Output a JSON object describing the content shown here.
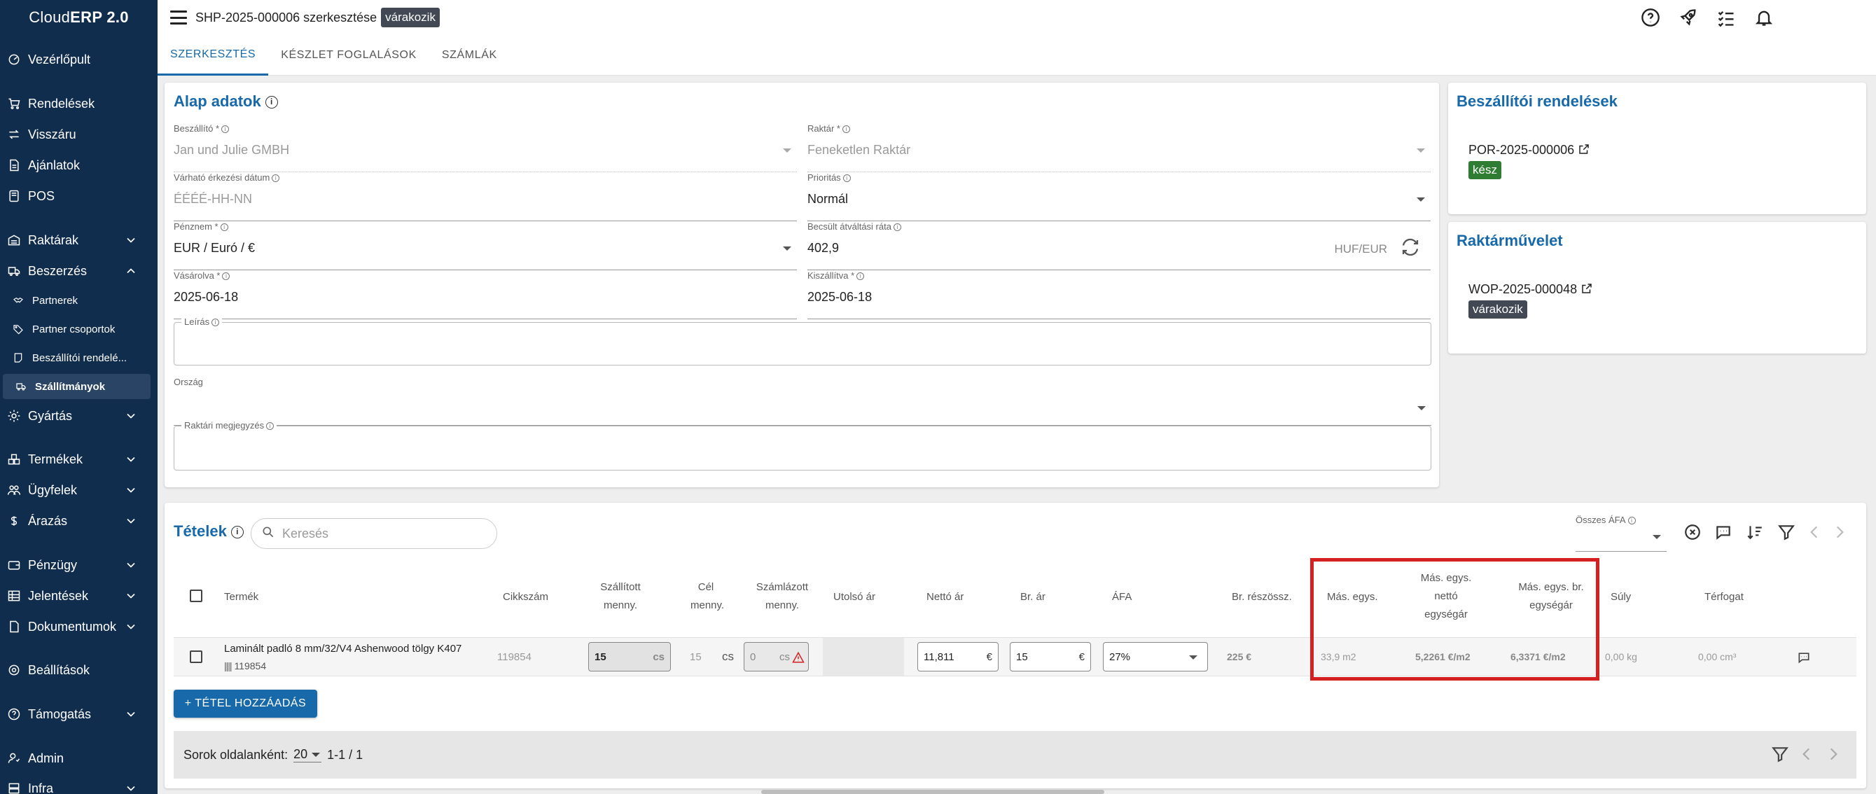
{
  "app": {
    "logo_prefix": "Cloud",
    "logo_bold": "ERP 2.0"
  },
  "sidebar": {
    "items": [
      {
        "label": "Vezérlőpult",
        "icon": "dashboard-icon"
      },
      {
        "label": "Rendelések",
        "icon": "cart-icon"
      },
      {
        "label": "Visszáru",
        "icon": "return-arrows-icon"
      },
      {
        "label": "Ajánlatok",
        "icon": "document-icon"
      },
      {
        "label": "POS",
        "icon": "pos-icon"
      },
      {
        "label": "Raktárak",
        "icon": "warehouse-icon"
      },
      {
        "label": "Beszerzés",
        "icon": "truck-icon"
      },
      {
        "label": "Partnerek",
        "icon": "handshake-icon"
      },
      {
        "label": "Partner csoportok",
        "icon": "tag-icon"
      },
      {
        "label": "Beszállítói rendelé...",
        "icon": "note-icon"
      },
      {
        "label": "Szállítmányok",
        "icon": "truck-icon"
      },
      {
        "label": "Gyártás",
        "icon": "gear-icon"
      },
      {
        "label": "Termékek",
        "icon": "boxes-icon"
      },
      {
        "label": "Ügyfelek",
        "icon": "users-icon"
      },
      {
        "label": "Árazás",
        "icon": "dollar-icon"
      },
      {
        "label": "Pénzügy",
        "icon": "wallet-icon"
      },
      {
        "label": "Jelentések",
        "icon": "table-icon"
      },
      {
        "label": "Dokumentumok",
        "icon": "file-icon"
      },
      {
        "label": "Beállítások",
        "icon": "settings-icon"
      },
      {
        "label": "Támogatás",
        "icon": "help-icon"
      },
      {
        "label": "Admin",
        "icon": "admin-icon"
      },
      {
        "label": "Infra",
        "icon": "server-icon"
      }
    ]
  },
  "header": {
    "title": "SHP-2025-000006 szerkesztése",
    "status": "várakozik"
  },
  "tabs": [
    "SZERKESZTÉS",
    "KÉSZLET FOGLALÁSOK",
    "SZÁMLÁK"
  ],
  "basic": {
    "title": "Alap adatok",
    "supplier_label": "Beszállító *",
    "supplier_value": "Jan und Julie GMBH",
    "warehouse_label": "Raktár *",
    "warehouse_value": "Feneketlen Raktár",
    "arrival_label": "Várható érkezési dátum",
    "arrival_placeholder": "ÉÉÉÉ-HH-NN",
    "priority_label": "Prioritás",
    "priority_value": "Normál",
    "currency_label": "Pénznem *",
    "currency_value": "EUR / Euró / €",
    "rate_label": "Becsült átváltási ráta",
    "rate_value": "402,9",
    "rate_unit": "HUF/EUR",
    "purchased_label": "Vásárolva *",
    "purchased_value": "2025-06-18",
    "shipped_label": "Kiszállítva *",
    "shipped_value": "2025-06-18",
    "description_label": "Leírás",
    "country_label": "Ország",
    "warehouse_note_label": "Raktári megjegyzés"
  },
  "supplier_orders": {
    "title": "Beszállítói rendelések",
    "code": "POR-2025-000006",
    "status": "kész"
  },
  "warehouse_ops": {
    "title": "Raktárművelet",
    "code": "WOP-2025-000048",
    "status": "várakozik"
  },
  "items": {
    "title": "Tételek",
    "search_placeholder": "Keresés",
    "vat_total_label": "Összes ÁFA",
    "columns": {
      "product": "Termék",
      "sku": "Cikkszám",
      "shipped_qty": "Szállított menny.",
      "target_qty": "Cél menny.",
      "invoiced_qty": "Számlázott menny.",
      "last_price": "Utolsó ár",
      "net_price": "Nettó ár",
      "gross_price": "Br. ár",
      "vat": "ÁFA",
      "gross_subtotal": "Br. részössz.",
      "alt_unit": "Más. egys.",
      "alt_net_unit_price": "Más. egys. nettó egységár",
      "alt_gross_unit_price": "Más. egys. br. egységár",
      "weight": "Súly",
      "volume": "Térfogat"
    },
    "row": {
      "product": "Laminált padló 8 mm/32/V4 Ashenwood tölgy K407",
      "barcode": "119854",
      "sku": "119854",
      "shipped_qty": "15",
      "shipped_unit": "cs",
      "target_qty": "15",
      "target_unit": "cs",
      "invoiced_qty": "0",
      "invoiced_unit": "cs",
      "net_price": "11,811",
      "net_unit": "€",
      "gross_price": "15",
      "gross_unit": "€",
      "vat": "27%",
      "gross_subtotal": "225 €",
      "alt_unit": "33,9 m2",
      "alt_net_unit_price": "5,2261 €/m2",
      "alt_gross_unit_price": "6,3371 €/m2",
      "weight": "0,00 kg",
      "volume": "0,00 cm³"
    },
    "add_button": "+ TÉTEL HOZZÁADÁS"
  },
  "pager": {
    "rows_label": "Sorok oldalanként:",
    "rows_value": "20",
    "range": "1-1 / 1"
  },
  "colors": {
    "sidebar": "#112d4e",
    "accent": "#1769aa",
    "success": "#2e7d32",
    "neutral_chip": "#424955",
    "highlight": "#d42020"
  }
}
